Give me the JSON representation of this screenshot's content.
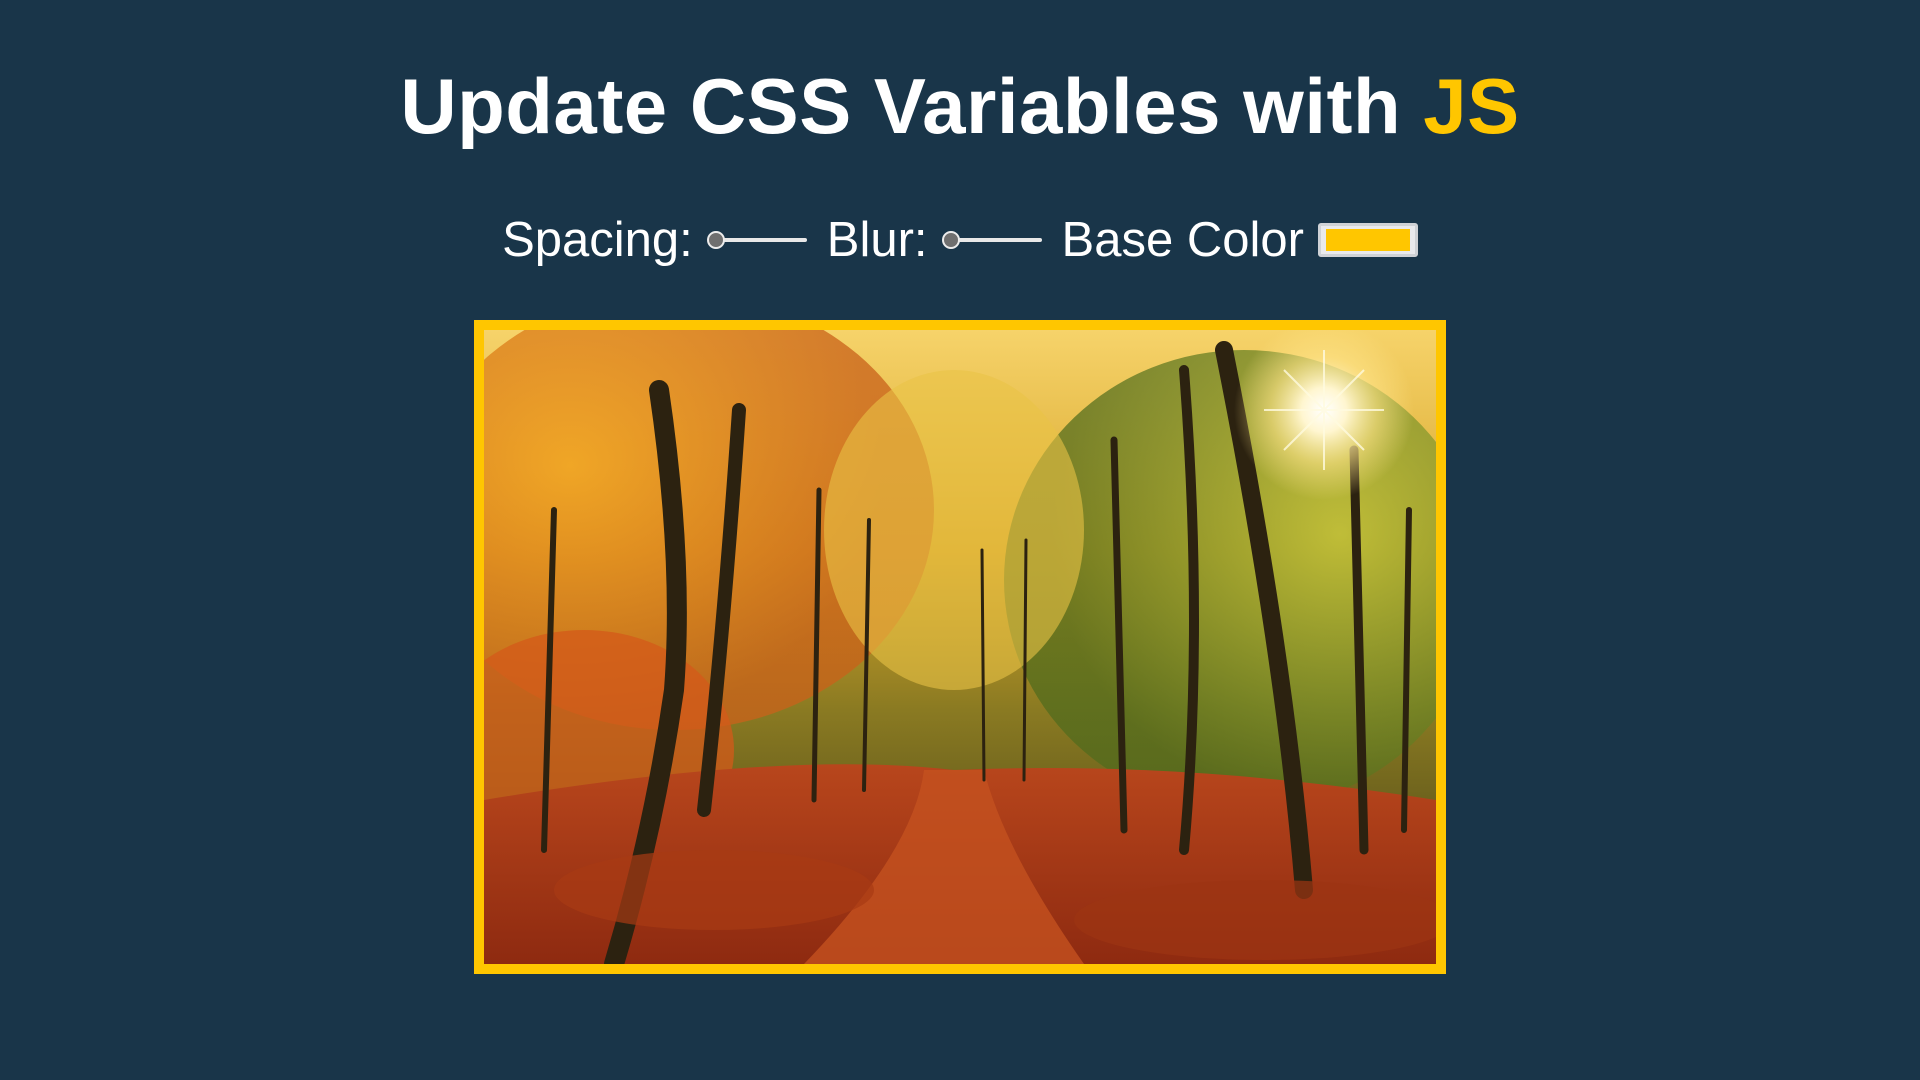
{
  "heading": {
    "main": "Update CSS Variables with ",
    "highlight": "JS"
  },
  "controls": {
    "spacing": {
      "label": "Spacing:",
      "value": 0
    },
    "blur": {
      "label": "Blur:",
      "value": 0
    },
    "base_color": {
      "label": "Base Color",
      "value": "#ffc600"
    }
  },
  "colors": {
    "background": "#193549",
    "accent": "#ffc600",
    "text": "#ffffff"
  },
  "image": {
    "subject": "autumn forest path with sun shining through trees"
  }
}
